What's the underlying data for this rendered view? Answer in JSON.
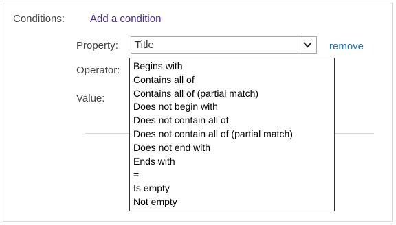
{
  "conditions": {
    "label": "Conditions:",
    "add_link": "Add a condition"
  },
  "property": {
    "label": "Property:",
    "selected": "Title",
    "remove_link": "remove"
  },
  "operator": {
    "label": "Operator:",
    "options": [
      "Begins with",
      "Contains all of",
      "Contains all of (partial match)",
      "Does not begin with",
      "Does not contain all of",
      "Does not contain all of (partial match)",
      "Does not end with",
      "Ends with",
      "=",
      "Is empty",
      "Not empty"
    ]
  },
  "value": {
    "label": "Value:"
  }
}
